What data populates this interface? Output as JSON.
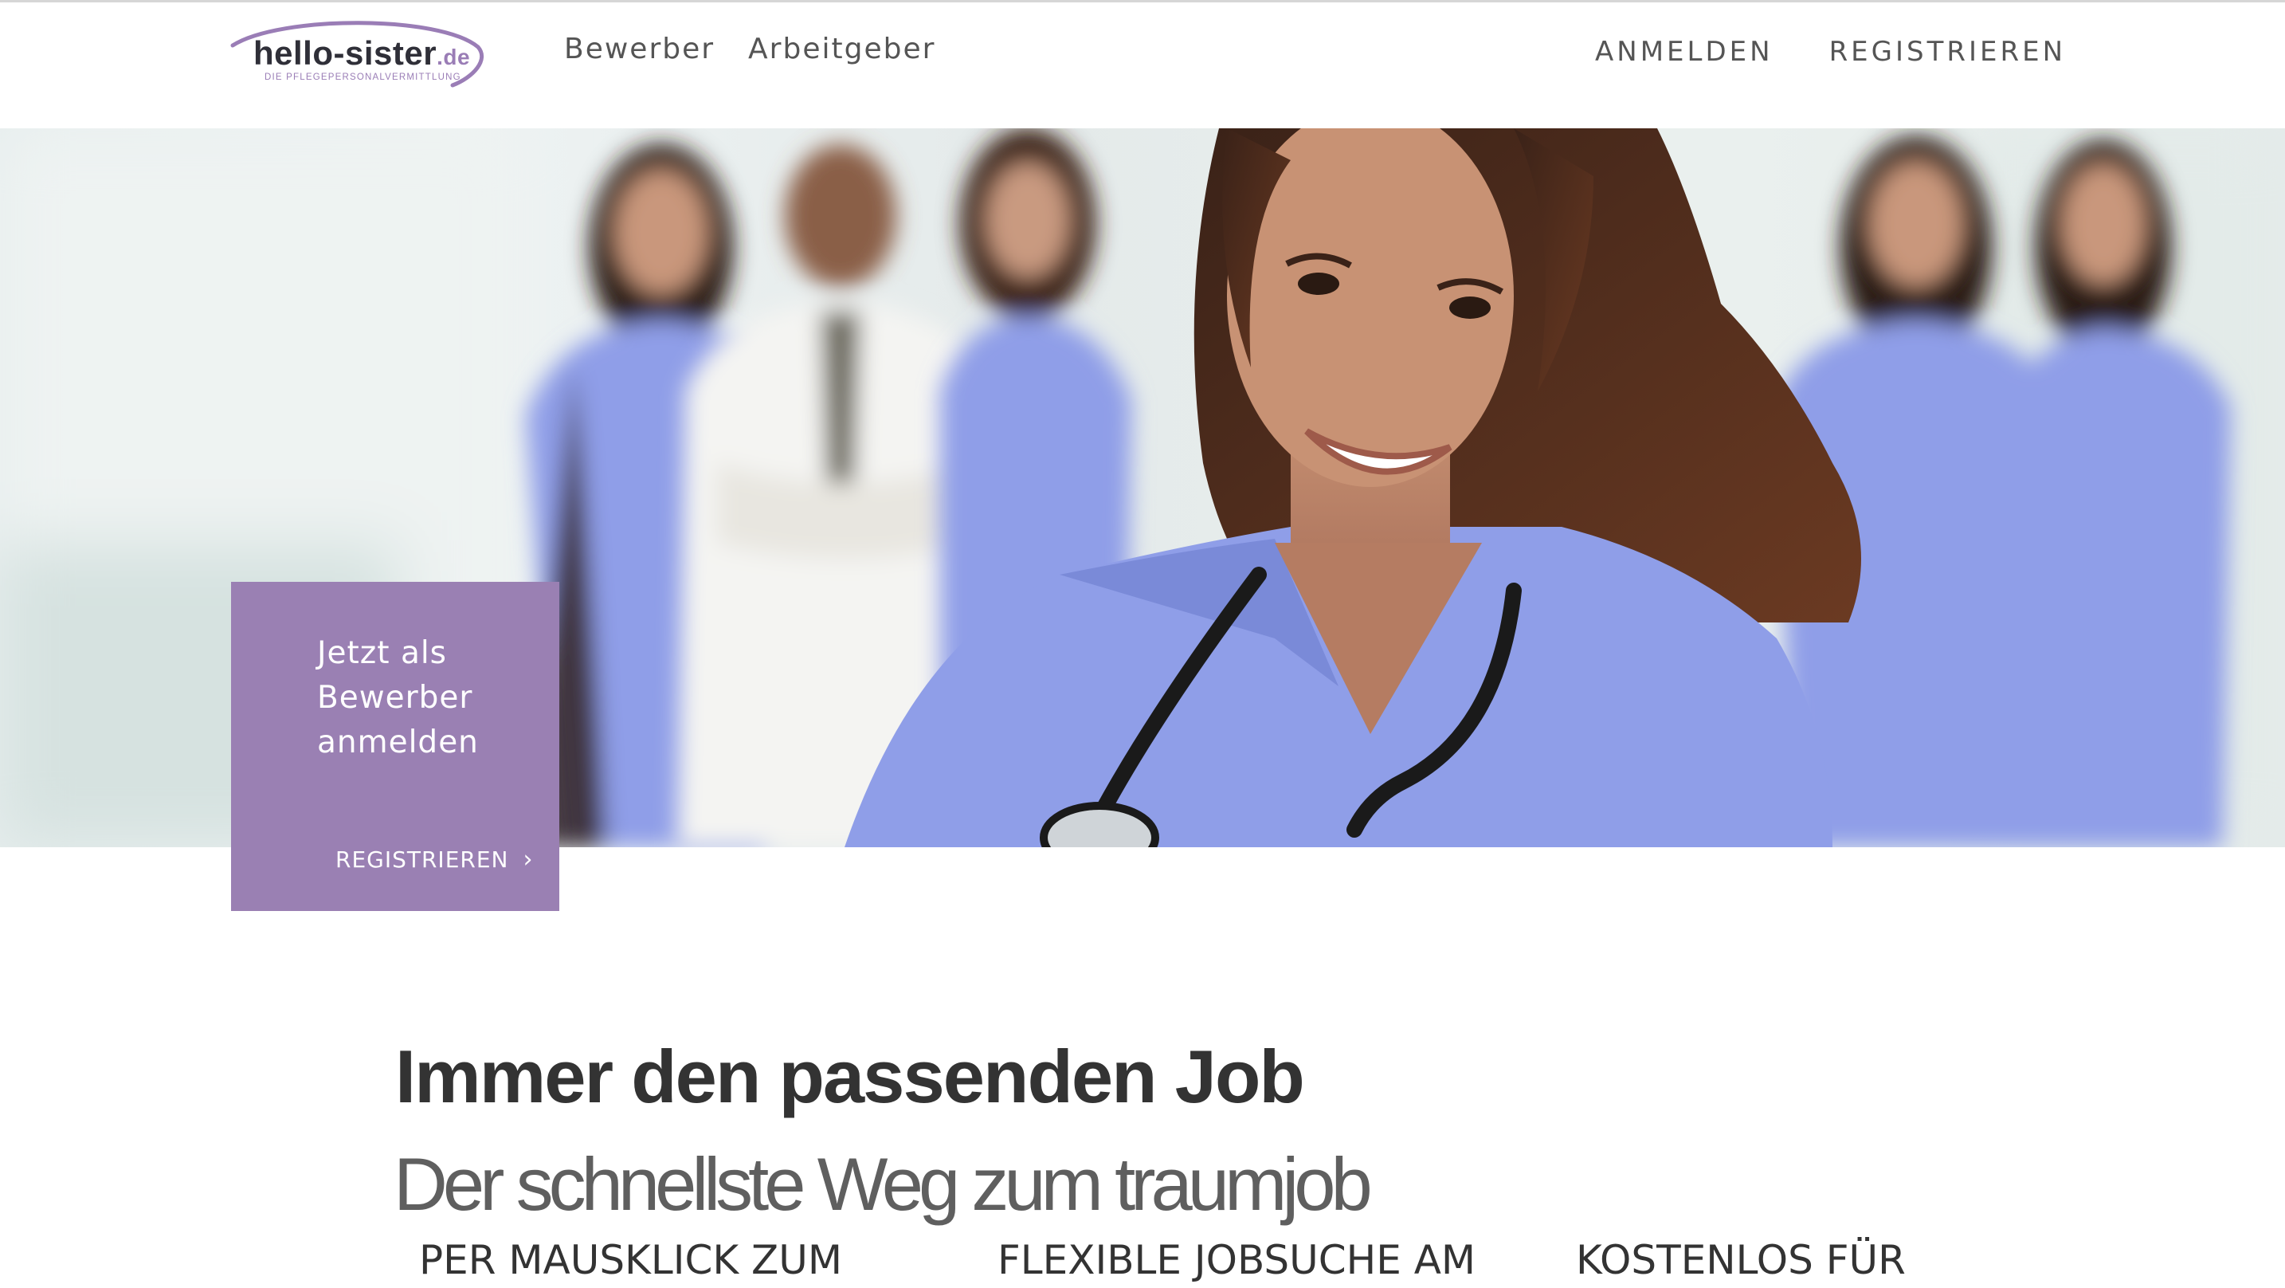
{
  "header": {
    "logo": {
      "brand": "hello-sister",
      "tld": ".de",
      "tagline": "DIE PFLEGEPERSONALVERMITTLUNG"
    },
    "nav_left": [
      "Bewerber",
      "Arbeitgeber"
    ],
    "nav_right": [
      "ANMELDEN",
      "REGISTRIEREN"
    ]
  },
  "hero": {
    "cta": {
      "text": "Jetzt als Bewerber anmelden",
      "link_label": "REGISTRIEREN",
      "background_color": "#9a80b3"
    }
  },
  "main": {
    "headline": "Immer den passenden Job",
    "subline": "Der schnellste Weg zum traumjob",
    "features": [
      "PER MAUSKLICK ZUM",
      "FLEXIBLE JOBSUCHE AM",
      "KOSTENLOS FÜR"
    ]
  },
  "colors": {
    "accent": "#9a80b3",
    "text_dark": "#333333",
    "scrubs": "#8f9ee8"
  }
}
